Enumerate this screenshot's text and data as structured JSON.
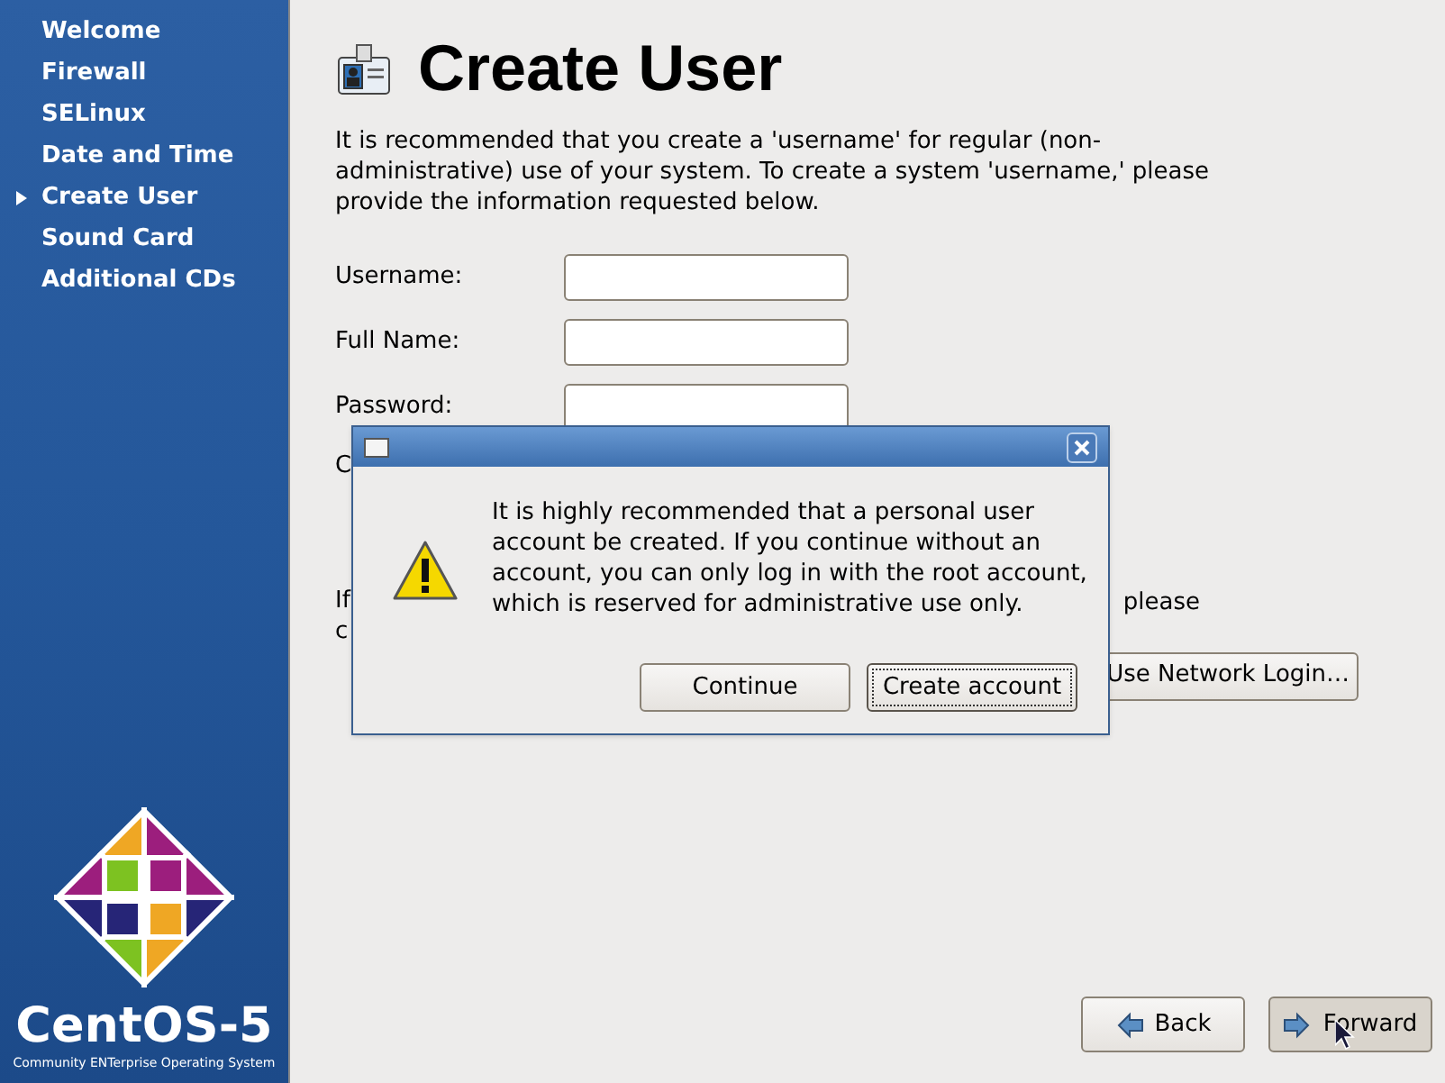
{
  "sidebar": {
    "items": [
      {
        "label": "Welcome",
        "selected": false
      },
      {
        "label": "Firewall",
        "selected": false
      },
      {
        "label": "SELinux",
        "selected": false
      },
      {
        "label": "Date and Time",
        "selected": false
      },
      {
        "label": "Create User",
        "selected": true
      },
      {
        "label": "Sound Card",
        "selected": false
      },
      {
        "label": "Additional CDs",
        "selected": false
      }
    ],
    "logo": {
      "name": "CentOS-5",
      "tagline": "Community ENTerprise Operating System"
    }
  },
  "page": {
    "title": "Create User",
    "intro": "It is recommended that you create a 'username' for regular (non-administrative) use of your system. To create a system 'username,' please provide the information requested below.",
    "fields": [
      {
        "label": "Username:"
      },
      {
        "label": "Full Name:"
      },
      {
        "label": "Password:"
      }
    ],
    "covered_texts": [
      {
        "text": "C"
      },
      {
        "text": "If"
      },
      {
        "text": "c"
      }
    ],
    "covered_right_text": "please",
    "network_button": "Use Network Login…"
  },
  "dialog": {
    "message": "It is highly recommended that a personal user account be created.  If you continue without an account, you can only log in with the root account, which is reserved for administrative use only.",
    "buttons": [
      {
        "label": "Continue",
        "focused": false
      },
      {
        "label": "Create account",
        "focused": true
      }
    ]
  },
  "nav_buttons": [
    {
      "label": "Back",
      "kind": "back",
      "hovered": false
    },
    {
      "label": "Forward",
      "kind": "forward",
      "hovered": true
    }
  ]
}
